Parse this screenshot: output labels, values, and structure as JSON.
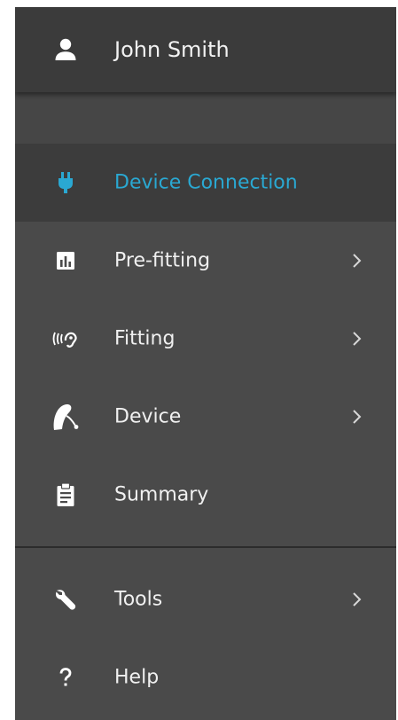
{
  "user": {
    "name": "John Smith",
    "icon": "person-icon"
  },
  "colors": {
    "panel": "#4a4a4a",
    "header": "#3b3b3b",
    "active_background": "#3c3c3c",
    "accent": "#2aa8d2",
    "text": "#f0f0f0"
  },
  "menu": {
    "device_connection": {
      "label": "Device Connection",
      "icon": "plug-icon",
      "active": true
    },
    "pre_fitting": {
      "label": "Pre-fitting",
      "icon": "bar-chart-icon",
      "has_submenu": true
    },
    "fitting": {
      "label": "Fitting",
      "icon": "ear-icon",
      "has_submenu": true
    },
    "device": {
      "label": "Device",
      "icon": "hearing-aid-icon",
      "has_submenu": true
    },
    "summary": {
      "label": "Summary",
      "icon": "clipboard-icon"
    },
    "tools": {
      "label": "Tools",
      "icon": "wrench-icon",
      "has_submenu": true
    },
    "help": {
      "label": "Help",
      "icon": "question-icon"
    }
  }
}
